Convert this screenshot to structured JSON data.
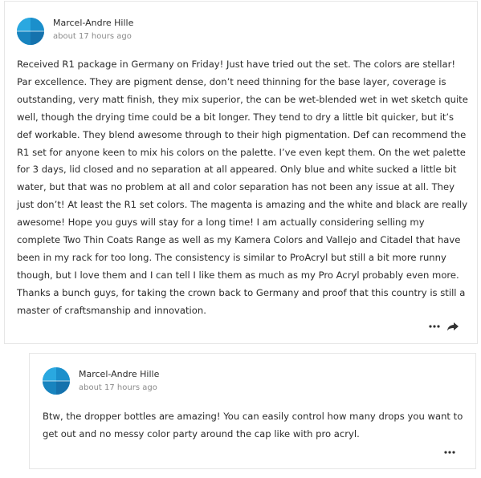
{
  "posts": [
    {
      "author": "Marcel-Andre Hille",
      "timestamp": "about 17 hours ago",
      "body": "Received R1 package in Germany on Friday! Just have tried out the set. The colors are stellar! Par excellence. They are pigment dense, don’t need thinning for the base layer, coverage is outstanding, very matt finish, they mix superior, the can be wet-blended wet in wet sketch quite well, though the drying time could be a bit longer. They tend to dry a little bit quicker, but it’s def workable. They blend awesome through to their high pigmentation. Def can recommend the R1 set for anyone keen to mix his colors on the palette. I’ve even kept them. On the wet palette for 3 days, lid closed and no separation at all appeared. Only blue and white sucked a little bit water, but that was no problem at all and color separation has not been any issue at all. They just don’t! At least the R1 set colors. The magenta is amazing and the white and black are really awesome! Hope you guys will stay for a long time! I am actually considering selling my complete Two Thin Coats Range as well as my Kamera Colors and Vallejo and Citadel that have been in my rack for too long. The consistency is similar to ProAcryl but still a bit more runny though, but I love them and I can tell I like them as much as my Pro Acryl probably even more. Thanks a bunch guys, for taking the crown back to Germany and proof that this country is still a master of craftsmanship and innovation.",
      "actions": [
        "more-options-icon",
        "share-icon"
      ]
    },
    {
      "author": "Marcel-Andre Hille",
      "timestamp": "about 17 hours ago",
      "body": "Btw, the dropper bottles are amazing! You can easily control how many drops you want to get out and no messy color party around the cap like with pro acryl.",
      "actions": [
        "more-options-icon"
      ]
    }
  ],
  "colors": {
    "avatar": "#1b9ad6",
    "text": "#2b2b2b",
    "muted": "#8a8a8a",
    "border": "#e6e6e6"
  }
}
